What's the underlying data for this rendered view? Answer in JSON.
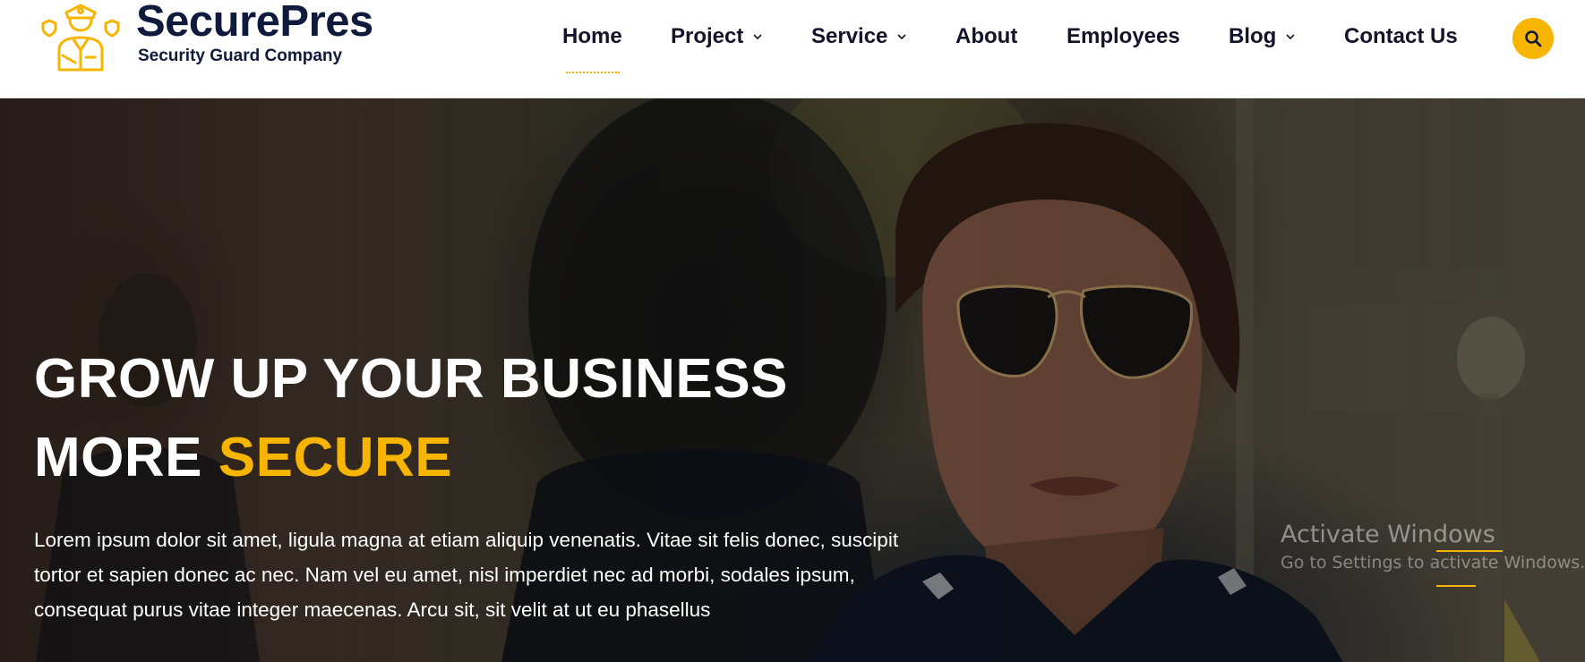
{
  "brand": {
    "name": "SecurePres",
    "tagline": "Security Guard Company",
    "logo_icon": "security-guard-icon",
    "accent_color": "#f7b500",
    "dark_color": "#101a3c"
  },
  "nav": {
    "items": [
      {
        "label": "Home",
        "active": true,
        "has_dropdown": false
      },
      {
        "label": "Project",
        "active": false,
        "has_dropdown": true
      },
      {
        "label": "Service",
        "active": false,
        "has_dropdown": true
      },
      {
        "label": "About",
        "active": false,
        "has_dropdown": false
      },
      {
        "label": "Employees",
        "active": false,
        "has_dropdown": false
      },
      {
        "label": "Blog",
        "active": false,
        "has_dropdown": true
      },
      {
        "label": "Contact Us",
        "active": false,
        "has_dropdown": false
      }
    ],
    "search_icon": "search-icon"
  },
  "hero": {
    "title_line1": "GROW UP YOUR BUSINESS",
    "title_line2_prefix": "MORE ",
    "title_line2_accent": "SECURE",
    "description": "Lorem ipsum dolor sit amet, ligula magna at etiam aliquip venenatis. Vitae sit felis donec, suscipit tortor et sapien donec ac nec. Nam vel eu amet, nisl imperdiet nec ad morbi, sodales ipsum, consequat purus vitae integer maecenas. Arcu sit, sit velit at ut eu phasellus",
    "background_image": "security-officer-photo"
  },
  "os_overlay": {
    "watermark_title": "Activate Windows",
    "watermark_subtitle": "Go to Settings to activate Windows."
  }
}
